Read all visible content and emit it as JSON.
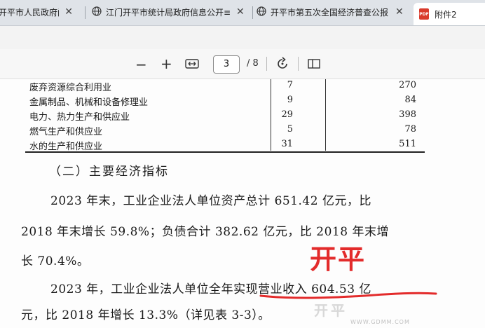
{
  "tabs": [
    {
      "label": "开平市人民政府门",
      "icon": "globe-icon"
    },
    {
      "label": "江门开平市统计局政府信息公开≡",
      "icon": "globe-icon"
    },
    {
      "label": "开平市第五次全国经济普查公报",
      "icon": "globe-icon"
    },
    {
      "label": "附件2",
      "icon": "pdf-icon"
    }
  ],
  "toolbar": {
    "current_page": "3",
    "total_pages": "/ 8"
  },
  "table_rows": [
    {
      "name": "废弃资源综合利用业",
      "count": "7",
      "value": "270"
    },
    {
      "name": "金属制品、机械和设备修理业",
      "count": "9",
      "value": "84"
    },
    {
      "name": "电力、热力生产和供应业",
      "count": "29",
      "value": "398"
    },
    {
      "name": "燃气生产和供应业",
      "count": "5",
      "value": "78"
    },
    {
      "name": "水的生产和供应业",
      "count": "31",
      "value": "511"
    }
  ],
  "section_heading": "（二）主要经济指标",
  "paragraphs": [
    "2023 年末，工业企业法人单位资产总计 651.42 亿元，比",
    "2018 年末增长 59.8%；负债合计 382.62 亿元，比 2018 年末增",
    "长 70.4%。",
    "2023 年，工业企业法人单位全年实现营业收入 604.53 亿",
    "元，比 2018 年增长 13.3%（详见表 3-3）。"
  ],
  "annotation": "开平",
  "watermark": "开平",
  "watermark_url": "WWW.GDMM.COM",
  "colors": {
    "annotation": "#e32b2b",
    "pdf_badge": "#d93a2b"
  }
}
